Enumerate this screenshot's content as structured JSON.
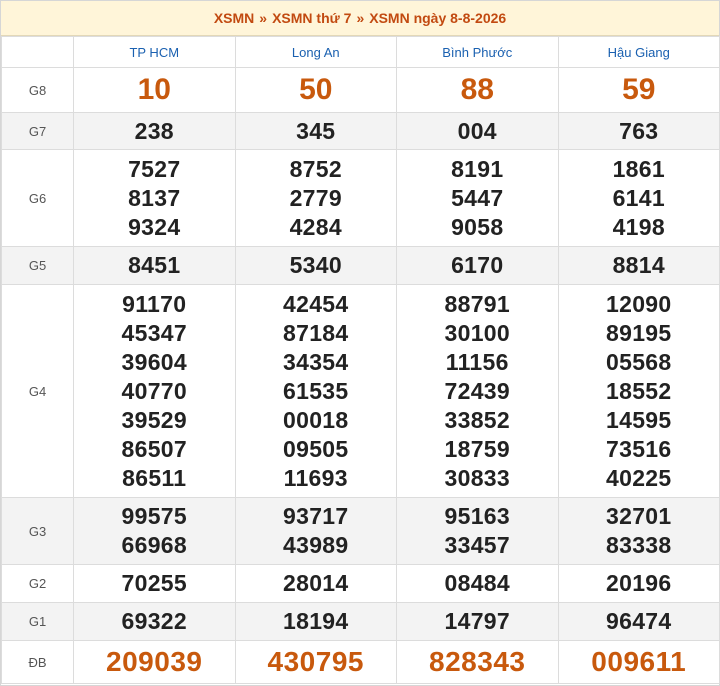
{
  "breadcrumb": {
    "item1": "XSMN",
    "item2": "XSMN thứ 7",
    "item3": "XSMN ngày 8-8-2026",
    "separator": "»"
  },
  "provinces": [
    "TP HCM",
    "Long An",
    "Bình Phước",
    "Hậu Giang"
  ],
  "prizes": [
    {
      "label": "G8",
      "values": [
        [
          "10"
        ],
        [
          "50"
        ],
        [
          "88"
        ],
        [
          "59"
        ]
      ]
    },
    {
      "label": "G7",
      "values": [
        [
          "238"
        ],
        [
          "345"
        ],
        [
          "004"
        ],
        [
          "763"
        ]
      ]
    },
    {
      "label": "G6",
      "values": [
        [
          "7527",
          "8137",
          "9324"
        ],
        [
          "8752",
          "2779",
          "4284"
        ],
        [
          "8191",
          "5447",
          "9058"
        ],
        [
          "1861",
          "6141",
          "4198"
        ]
      ]
    },
    {
      "label": "G5",
      "values": [
        [
          "8451"
        ],
        [
          "5340"
        ],
        [
          "6170"
        ],
        [
          "8814"
        ]
      ]
    },
    {
      "label": "G4",
      "values": [
        [
          "91170",
          "45347",
          "39604",
          "40770",
          "39529",
          "86507",
          "86511"
        ],
        [
          "42454",
          "87184",
          "34354",
          "61535",
          "00018",
          "09505",
          "11693"
        ],
        [
          "88791",
          "30100",
          "11156",
          "72439",
          "33852",
          "18759",
          "30833"
        ],
        [
          "12090",
          "89195",
          "05568",
          "18552",
          "14595",
          "73516",
          "40225"
        ]
      ]
    },
    {
      "label": "G3",
      "values": [
        [
          "99575",
          "66968"
        ],
        [
          "93717",
          "43989"
        ],
        [
          "95163",
          "33457"
        ],
        [
          "32701",
          "83338"
        ]
      ]
    },
    {
      "label": "G2",
      "values": [
        [
          "70255"
        ],
        [
          "28014"
        ],
        [
          "08484"
        ],
        [
          "20196"
        ]
      ]
    },
    {
      "label": "G1",
      "values": [
        [
          "69322"
        ],
        [
          "18194"
        ],
        [
          "14797"
        ],
        [
          "96474"
        ]
      ]
    },
    {
      "label": "ĐB",
      "values": [
        [
          "209039"
        ],
        [
          "430795"
        ],
        [
          "828343"
        ],
        [
          "009611"
        ]
      ]
    }
  ],
  "colors": {
    "accent": "#c8590d",
    "province_link": "#1a60b0",
    "title_bg": "#fff5d9"
  }
}
